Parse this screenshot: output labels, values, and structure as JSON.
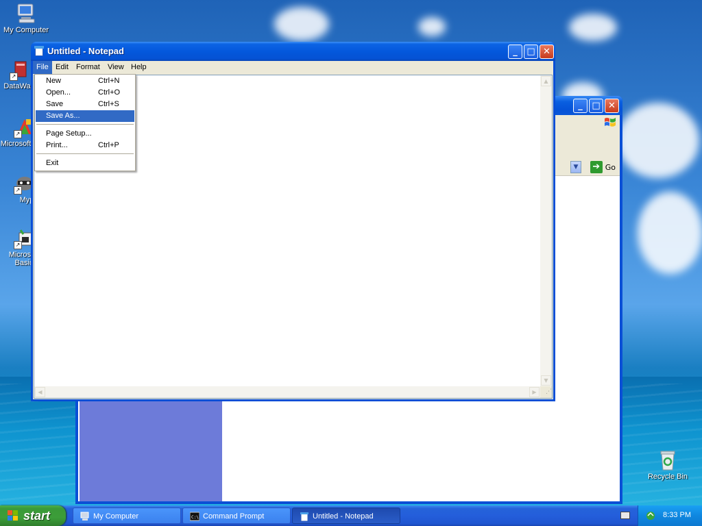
{
  "desktop": {
    "icons": [
      {
        "label": "My Computer",
        "icon": "my-computer-icon"
      },
      {
        "label": "DataWa",
        "icon": "database-shortcut-icon"
      },
      {
        "label": "Microsoft C++",
        "icon": "visual-cpp-shortcut-icon"
      },
      {
        "label": "Myp",
        "icon": "raccoon-shortcut-icon"
      },
      {
        "label": "Microsoft Basic",
        "icon": "visual-basic-shortcut-icon"
      },
      {
        "label": "Recycle Bin",
        "icon": "recycle-bin-icon"
      }
    ]
  },
  "background_window": {
    "go_label": "Go",
    "colors": {
      "left_pane": "#6d7bd9"
    }
  },
  "notepad": {
    "title": "Untitled - Notepad",
    "menu": [
      "File",
      "Edit",
      "Format",
      "View",
      "Help"
    ],
    "active_menu": "File",
    "text": ""
  },
  "file_menu": {
    "items": [
      {
        "label": "New",
        "shortcut": "Ctrl+N"
      },
      {
        "label": "Open...",
        "shortcut": "Ctrl+O"
      },
      {
        "label": "Save",
        "shortcut": "Ctrl+S"
      },
      {
        "label": "Save As...",
        "shortcut": "",
        "highlighted": true
      },
      {
        "label": "Page Setup...",
        "shortcut": ""
      },
      {
        "label": "Print...",
        "shortcut": "Ctrl+P"
      },
      {
        "label": "Exit",
        "shortcut": ""
      }
    ]
  },
  "taskbar": {
    "start_label": "start",
    "buttons": [
      {
        "label": "My Computer",
        "icon": "my-computer-icon"
      },
      {
        "label": "Command Prompt",
        "icon": "command-prompt-icon"
      },
      {
        "label": "Untitled - Notepad",
        "icon": "notepad-icon",
        "active": true
      }
    ],
    "clock": "8:33 PM"
  },
  "colors": {
    "title_bar": "#0458dc",
    "menu_highlight": "#316ac5",
    "start_green": "#3c9d39",
    "close_red": "#c73b1c"
  }
}
